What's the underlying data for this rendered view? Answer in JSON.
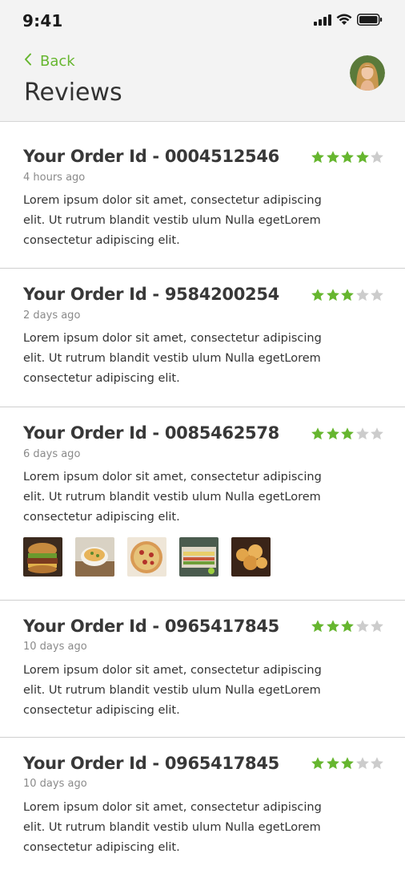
{
  "status_bar": {
    "time": "9:41",
    "icons": [
      "signal-icon",
      "wifi-icon",
      "battery-icon"
    ]
  },
  "header": {
    "back_label": "Back",
    "title": "Reviews"
  },
  "colors": {
    "accent": "#66b62f",
    "star_on": "#66b62f",
    "star_off": "#cccccc",
    "header_bg": "#f3f3f3"
  },
  "reviews": [
    {
      "title": "Your Order Id - 0004512546",
      "time": "4 hours ago",
      "rating": 4,
      "max_rating": 5,
      "body": "Lorem ipsum dolor sit amet, consectetur adipiscing elit. Ut rutrum blandit vestib ulum Nulla egetLorem consectetur adipiscing elit.",
      "photos": []
    },
    {
      "title": "Your Order Id - 9584200254",
      "time": "2 days ago",
      "rating": 3,
      "max_rating": 5,
      "body": "Lorem ipsum dolor sit amet, consectetur adipiscing elit. Ut rutrum blandit vestib ulum Nulla egetLorem consectetur adipiscing elit.",
      "photos": []
    },
    {
      "title": "Your Order Id - 0085462578",
      "time": "6 days ago",
      "rating": 3,
      "max_rating": 5,
      "body": "Lorem ipsum dolor sit amet, consectetur adipiscing elit. Ut rutrum blandit vestib ulum Nulla egetLorem consectetur adipiscing elit.",
      "photos": [
        "burger-photo",
        "soup-photo",
        "pizza-photo",
        "sandwich-photo",
        "pastry-photo"
      ]
    },
    {
      "title": "Your Order Id - 0965417845",
      "time": "10 days ago",
      "rating": 3,
      "max_rating": 5,
      "body": "Lorem ipsum dolor sit amet, consectetur adipiscing elit. Ut rutrum blandit vestib ulum Nulla egetLorem consectetur adipiscing elit.",
      "photos": []
    },
    {
      "title": "Your Order Id - 0965417845",
      "time": "10 days ago",
      "rating": 3,
      "max_rating": 5,
      "body": "Lorem ipsum dolor sit amet, consectetur adipiscing elit. Ut rutrum blandit vestib ulum Nulla egetLorem consectetur adipiscing elit.",
      "photos": []
    }
  ]
}
